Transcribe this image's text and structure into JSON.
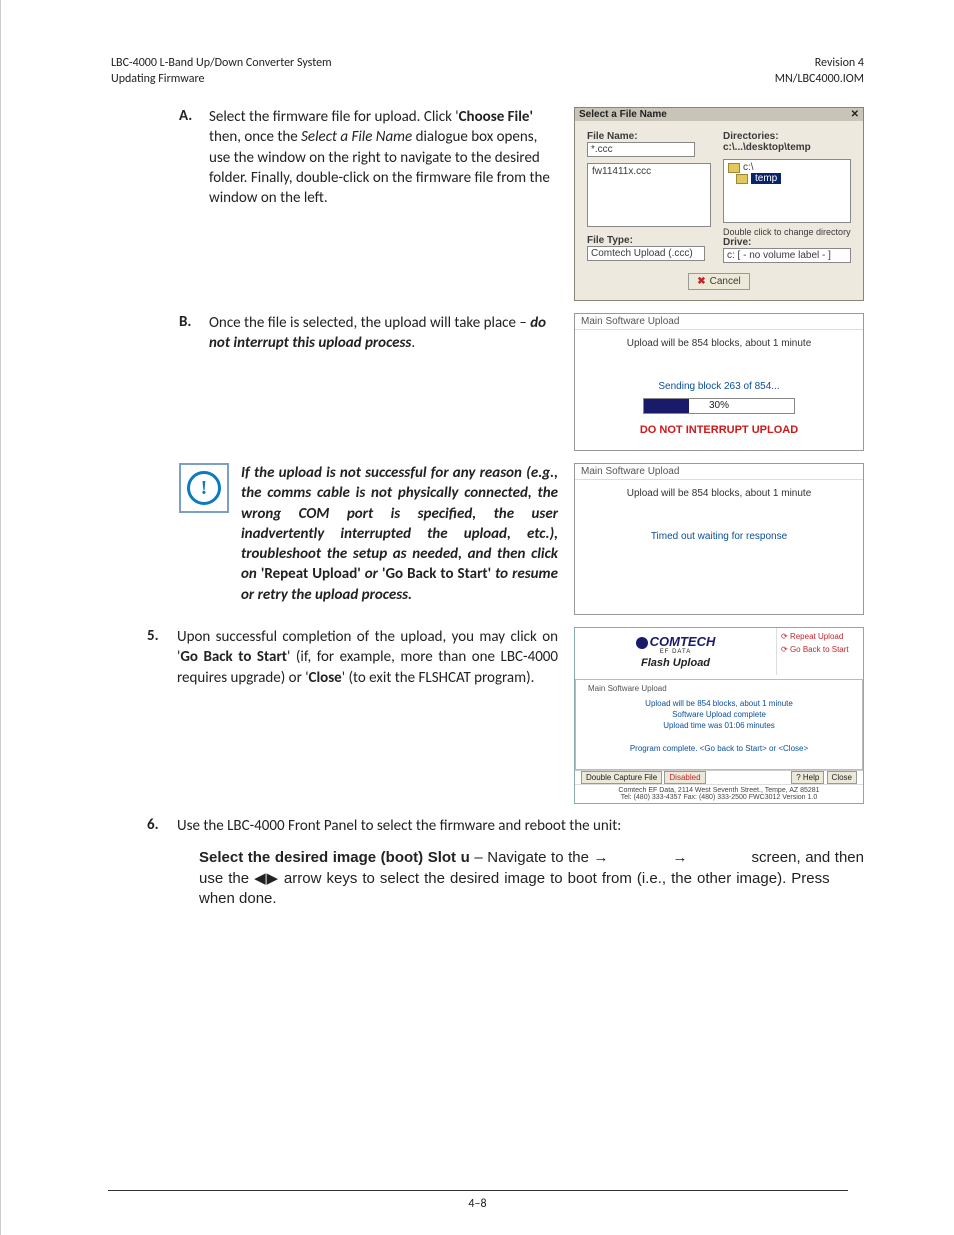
{
  "header": {
    "left": "LBC-4000 L-Band Up/Down Converter System\nUpdating Firmware",
    "right": "Revision 4\nMN/LBC4000.IOM"
  },
  "stepA": {
    "letter": "A.",
    "pre": "Select the firmware file for upload. Click '",
    "choose": "Choose File'",
    "mid1": " then, once the ",
    "ital": "Select a File Name",
    "post": " dialogue box opens, use the window on the right to navigate to the desired folder. Finally, double-click on the firmware file from the window on the left."
  },
  "fileDialog": {
    "title": "Select a File Name",
    "fileNameLabel": "File Name:",
    "fileNameValue": "*.ccc",
    "fileListItem": "fw11411x.ccc",
    "directoriesLabel": "Directories:",
    "directoriesPath": "c:\\...\\desktop\\temp",
    "dirRoot": "c:\\",
    "dirSel": "temp",
    "doubleClickNote": "Double click to change directory",
    "fileTypeLabel": "File Type:",
    "fileTypeValue": "Comtech Upload (.ccc)",
    "driveLabel": "Drive:",
    "driveValue": "c: [ - no volume label - ]",
    "cancel": "Cancel"
  },
  "stepB": {
    "letter": "B.",
    "text1": "Once the file is selected, the upload will take place – ",
    "text2": "do not interrupt this upload process",
    "text3": "."
  },
  "progress1": {
    "title": "Main Software Upload",
    "info": "Upload will be 854 blocks, about 1 minute",
    "status": "Sending block 263 of 854...",
    "percent": "30%",
    "fillPct": 30,
    "warn": "DO NOT INTERRUPT UPLOAD"
  },
  "caution": {
    "l1": "If the upload is not successful for any reason (e.g., the comms cable is not physically connected, the wrong COM port is specified, the user inadvertently interrupted the upload, etc.), troubleshoot the setup as needed, and then click on",
    "l2a": "'Repeat Upload'",
    "l2b": " or ",
    "l2c": "'Go Back to Start'",
    "l2d": " to resume or retry the upload process."
  },
  "progress2": {
    "title": "Main Software Upload",
    "info": "Upload will be 854 blocks, about 1 minute",
    "status": "Timed out waiting for response"
  },
  "step5": {
    "num": "5.",
    "t1": "Upon successful completion of the upload, you may click on '",
    "t2": "Go Back to Start",
    "t3": "' (if, for example, more than one LBC-4000 requires upgrade) or '",
    "t4": "Close",
    "t5": "' (to exit the FLSHCAT program)."
  },
  "flash": {
    "brand": "COMTECH",
    "brand2": "EF DATA",
    "title": "Flash Upload",
    "sideRepeat": "Repeat Upload",
    "sideBack": "Go Back to Start",
    "grp": "Main Software Upload",
    "n1": "Upload will be 854 blocks, about 1 minute",
    "n2": "Software Upload complete",
    "n3": "Upload time was 01:06 minutes",
    "n4": "Program complete. <Go back to Start> or <Close>",
    "dbl1": "Double Capture File",
    "dbl2": "Disabled",
    "help": "? Help",
    "close": "Close",
    "legal1": "Comtech EF Data, 2114 West Seventh Street., Tempe, AZ 85281",
    "legal2": "Tel: (480) 333-4357    Fax: (480) 333-2500    FWC3012    Version 1.0"
  },
  "step6": {
    "num": "6.",
    "text": "Use the LBC-4000 Front Panel to select the firmware and reboot the unit:"
  },
  "bootPara": {
    "b1": "Select the desired image (boot) Slot u",
    "t1": " – Navigate to the ",
    "arrow": " → ",
    "t2": " screen, and then use the ◀▶ arrow keys to select the desired image to boot from (i.e., the other image). Press ",
    "t3": " when done."
  },
  "footer": {
    "page": "4–8"
  }
}
